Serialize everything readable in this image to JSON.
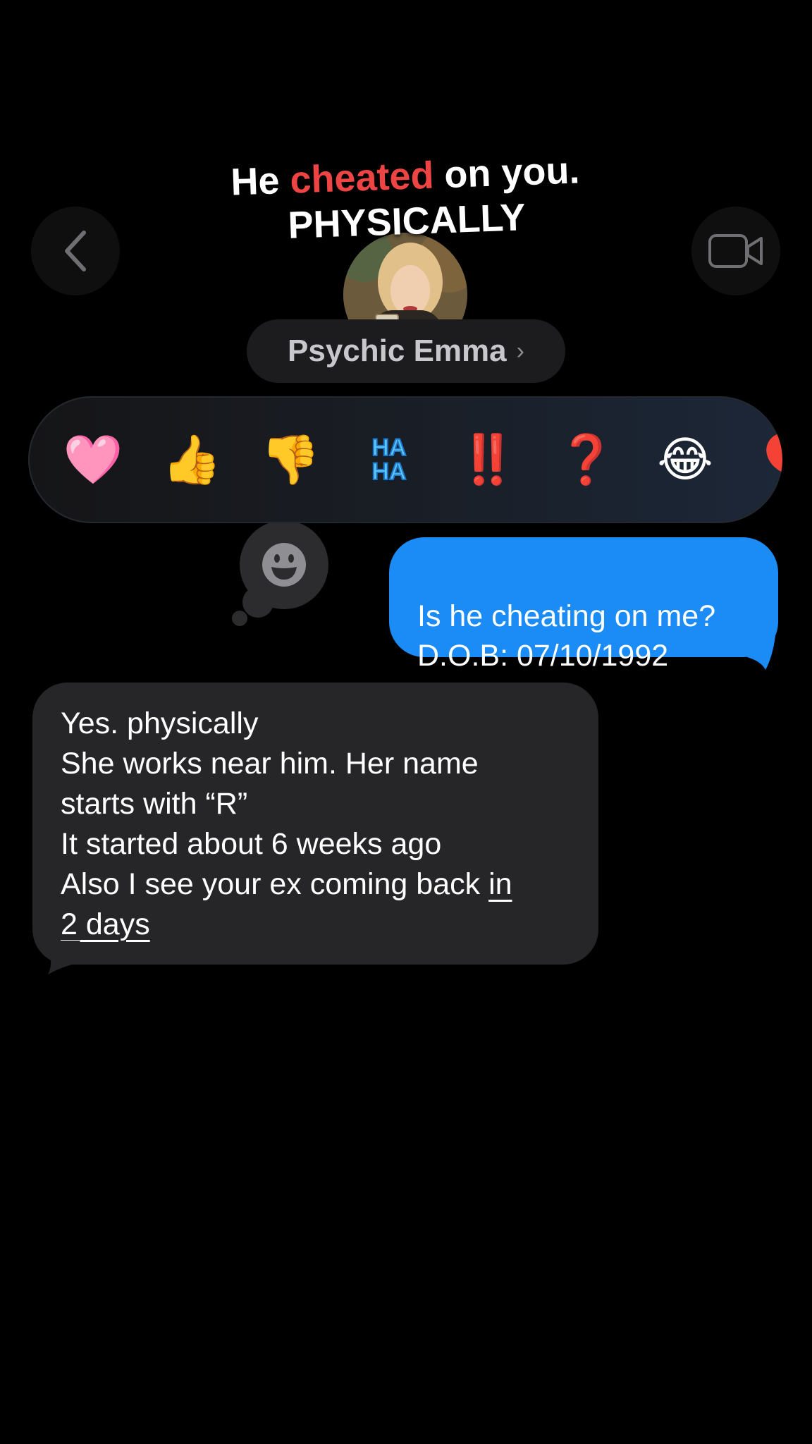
{
  "caption": {
    "line1_pre": "He",
    "line1_highlight": "cheated",
    "line1_post": "on you.",
    "line2": "PHYSICALLY",
    "highlight_color": "#ef4444"
  },
  "header": {
    "back_icon": "chevron-left-icon",
    "video_icon": "video-camera-icon",
    "contact_name": "Psychic Emma",
    "contact_chevron": "›"
  },
  "reactions": [
    {
      "name": "heart",
      "glyph": "🩷"
    },
    {
      "name": "thumbs-up",
      "glyph": "👍"
    },
    {
      "name": "thumbs-down",
      "glyph": "👎"
    },
    {
      "name": "haha",
      "line1": "HA",
      "line2": "HA"
    },
    {
      "name": "exclamation",
      "glyph": "‼️"
    },
    {
      "name": "question",
      "glyph": "❓"
    },
    {
      "name": "laughing",
      "glyph": "😂"
    },
    {
      "name": "balloon",
      "glyph": "🎈"
    }
  ],
  "add_reaction_icon": "smiley-face-icon",
  "messages": {
    "outgoing": {
      "text": "Is he cheating on me?\nD.O.B: 07/10/1992",
      "color": "#1b8bf5"
    },
    "incoming": {
      "line1": "Yes. physically",
      "line2": "She works near him. Her name",
      "line3": "starts with “R”",
      "line4": "It started about 6 weeks ago",
      "line5_pre": "Also I see your ex coming back ",
      "line5_link": "in",
      "line6_link": "2 days",
      "color": "#262628"
    }
  }
}
